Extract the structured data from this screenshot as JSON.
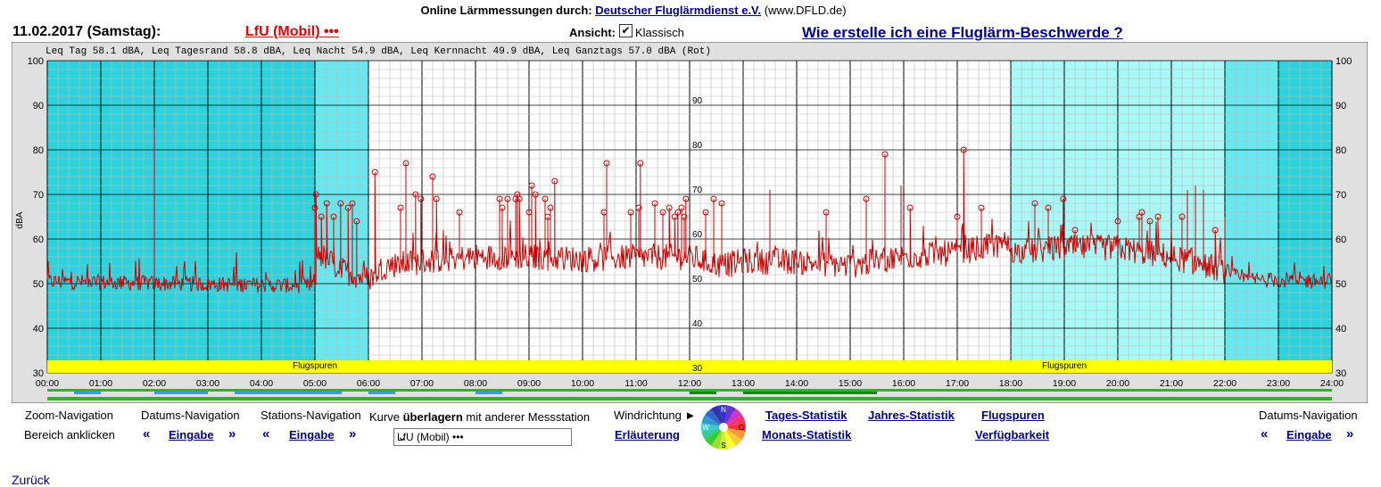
{
  "header": {
    "prefix": "Online Lärmmessungen durch:",
    "org_link": "Deutscher Fluglärmdienst e.V.",
    "org_url_text": "(www.DFLD.de)"
  },
  "date_title": "11.02.2017 (Samstag):",
  "station": "LfU (Mobil) •••",
  "view": {
    "label": "Ansicht:",
    "option": "Klassisch",
    "checked": true
  },
  "complaint_link": "Wie erstelle ich eine Fluglärm-Beschwerde ?",
  "chart_data": {
    "type": "line",
    "summary": "Leq Tag 58.1 dBA, Leq Tagesrand 58.8 dBA, Leq Nacht 54.9 dBA, Leq Kernnacht 49.9 dBA, Leq Ganztags 57.0 dBA (Rot)",
    "ylabel": "dBA",
    "ylim": [
      30,
      100
    ],
    "yticks": [
      30,
      40,
      50,
      60,
      70,
      80,
      90,
      100
    ],
    "inner_yticks": [
      30,
      40,
      50,
      60,
      70,
      80,
      90
    ],
    "xlim_hours": [
      0,
      24
    ],
    "xticks": [
      "00:00",
      "01:00",
      "02:00",
      "03:00",
      "04:00",
      "05:00",
      "06:00",
      "07:00",
      "08:00",
      "09:00",
      "10:00",
      "11:00",
      "12:00",
      "13:00",
      "14:00",
      "15:00",
      "16:00",
      "17:00",
      "18:00",
      "19:00",
      "20:00",
      "21:00",
      "22:00",
      "23:00",
      "24:00"
    ],
    "band_label": "Flugspuren",
    "colors": {
      "night": "#2dd3dc",
      "night_light": "#66e8ee",
      "evening": "#a8f8f8",
      "line": "#cc0000",
      "band": "#ffff00",
      "timeline": "#22bb22",
      "timeline_dark": "#118811",
      "timeline_blue": "#3399ff"
    },
    "baseline": [
      [
        0,
        50.5
      ],
      [
        5,
        49.5
      ],
      [
        5.05,
        57
      ],
      [
        5.5,
        53
      ],
      [
        6,
        51
      ],
      [
        6.3,
        54
      ],
      [
        7,
        55
      ],
      [
        8,
        56
      ],
      [
        9,
        56
      ],
      [
        10,
        55.5
      ],
      [
        11,
        56
      ],
      [
        12,
        56
      ],
      [
        12.6,
        54
      ],
      [
        13,
        55
      ],
      [
        14,
        55
      ],
      [
        15,
        54
      ],
      [
        16,
        56
      ],
      [
        17,
        57
      ],
      [
        17.9,
        59
      ],
      [
        18.1,
        57
      ],
      [
        19,
        58
      ],
      [
        20,
        58
      ],
      [
        21,
        56
      ],
      [
        22,
        53
      ],
      [
        22.3,
        51
      ],
      [
        24,
        50.5
      ]
    ],
    "peaks": [
      [
        2.0,
        85,
        false
      ],
      [
        5.0,
        67,
        true
      ],
      [
        5.02,
        70,
        true
      ],
      [
        5.12,
        65,
        true
      ],
      [
        5.22,
        68,
        true
      ],
      [
        5.35,
        65,
        true
      ],
      [
        5.48,
        68,
        true
      ],
      [
        5.62,
        67,
        true
      ],
      [
        5.7,
        68,
        true
      ],
      [
        5.78,
        64,
        true
      ],
      [
        6.12,
        75,
        true
      ],
      [
        6.6,
        67,
        true
      ],
      [
        6.7,
        77,
        true
      ],
      [
        6.88,
        70,
        true
      ],
      [
        6.98,
        69,
        true
      ],
      [
        7.2,
        74,
        true
      ],
      [
        7.27,
        69,
        true
      ],
      [
        7.7,
        66,
        true
      ],
      [
        8.45,
        69,
        true
      ],
      [
        8.5,
        67,
        true
      ],
      [
        8.6,
        69,
        true
      ],
      [
        8.75,
        69,
        true
      ],
      [
        8.78,
        70,
        true
      ],
      [
        8.82,
        69,
        true
      ],
      [
        9.0,
        66,
        true
      ],
      [
        9.05,
        72,
        true
      ],
      [
        9.12,
        70,
        true
      ],
      [
        9.3,
        69,
        true
      ],
      [
        9.35,
        65,
        true
      ],
      [
        9.4,
        67,
        true
      ],
      [
        9.48,
        73,
        true
      ],
      [
        10.4,
        66,
        true
      ],
      [
        10.45,
        77,
        true
      ],
      [
        10.9,
        66,
        true
      ],
      [
        11.05,
        67,
        true
      ],
      [
        11.08,
        77,
        true
      ],
      [
        11.35,
        68,
        true
      ],
      [
        11.5,
        66,
        true
      ],
      [
        11.62,
        67,
        true
      ],
      [
        11.72,
        65,
        true
      ],
      [
        11.78,
        66,
        true
      ],
      [
        11.85,
        67,
        true
      ],
      [
        11.9,
        65,
        true
      ],
      [
        11.93,
        69,
        true
      ],
      [
        12.3,
        66,
        true
      ],
      [
        12.45,
        69,
        true
      ],
      [
        12.6,
        68,
        true
      ],
      [
        13.5,
        71,
        false
      ],
      [
        14.55,
        66,
        true
      ],
      [
        15.3,
        69,
        true
      ],
      [
        15.65,
        79,
        true
      ],
      [
        15.95,
        72,
        false
      ],
      [
        16.12,
        67,
        true
      ],
      [
        17.0,
        65,
        true
      ],
      [
        17.12,
        80,
        true
      ],
      [
        17.45,
        67,
        true
      ],
      [
        18.45,
        68,
        true
      ],
      [
        18.7,
        67,
        true
      ],
      [
        18.98,
        69,
        true
      ],
      [
        19.2,
        62,
        true
      ],
      [
        20.0,
        64,
        true
      ],
      [
        20.4,
        65,
        true
      ],
      [
        20.45,
        66,
        true
      ],
      [
        20.6,
        64,
        true
      ],
      [
        20.75,
        65,
        true
      ],
      [
        21.2,
        65,
        true
      ],
      [
        21.3,
        71,
        false
      ],
      [
        21.45,
        72,
        false
      ],
      [
        21.6,
        71,
        false
      ],
      [
        21.82,
        62,
        true
      ],
      [
        22.0,
        65,
        false
      ]
    ]
  },
  "bottom": {
    "zoom_nav": "Zoom-Navigation",
    "zoom_hint": "Bereich anklicken",
    "date_nav": "Datums-Navigation",
    "date_input": "Eingabe",
    "station_nav": "Stations-Navigation",
    "station_input": "Eingabe",
    "overlay_prefix": "Kurve",
    "overlay_bold": "überlagern",
    "overlay_suffix": "mit anderer Messstation",
    "overlay_value": "LfU (Mobil) •••",
    "wind_label": "Windrichtung ►",
    "wind_explain": "Erläuterung",
    "compass": [
      "N",
      "O",
      "S",
      "W"
    ],
    "daily_stats": "Tages-Statistik",
    "monthly_stats": "Monats-Statistik",
    "yearly_stats": "Jahres-Statistik",
    "flight_tracks": "Flugspuren",
    "availability": "Verfügbarkeit",
    "date_nav_right": "Datums-Navigation",
    "date_input_right": "Eingabe",
    "prev_arrow": "«",
    "next_arrow": "»",
    "back_link": "Zurück"
  }
}
